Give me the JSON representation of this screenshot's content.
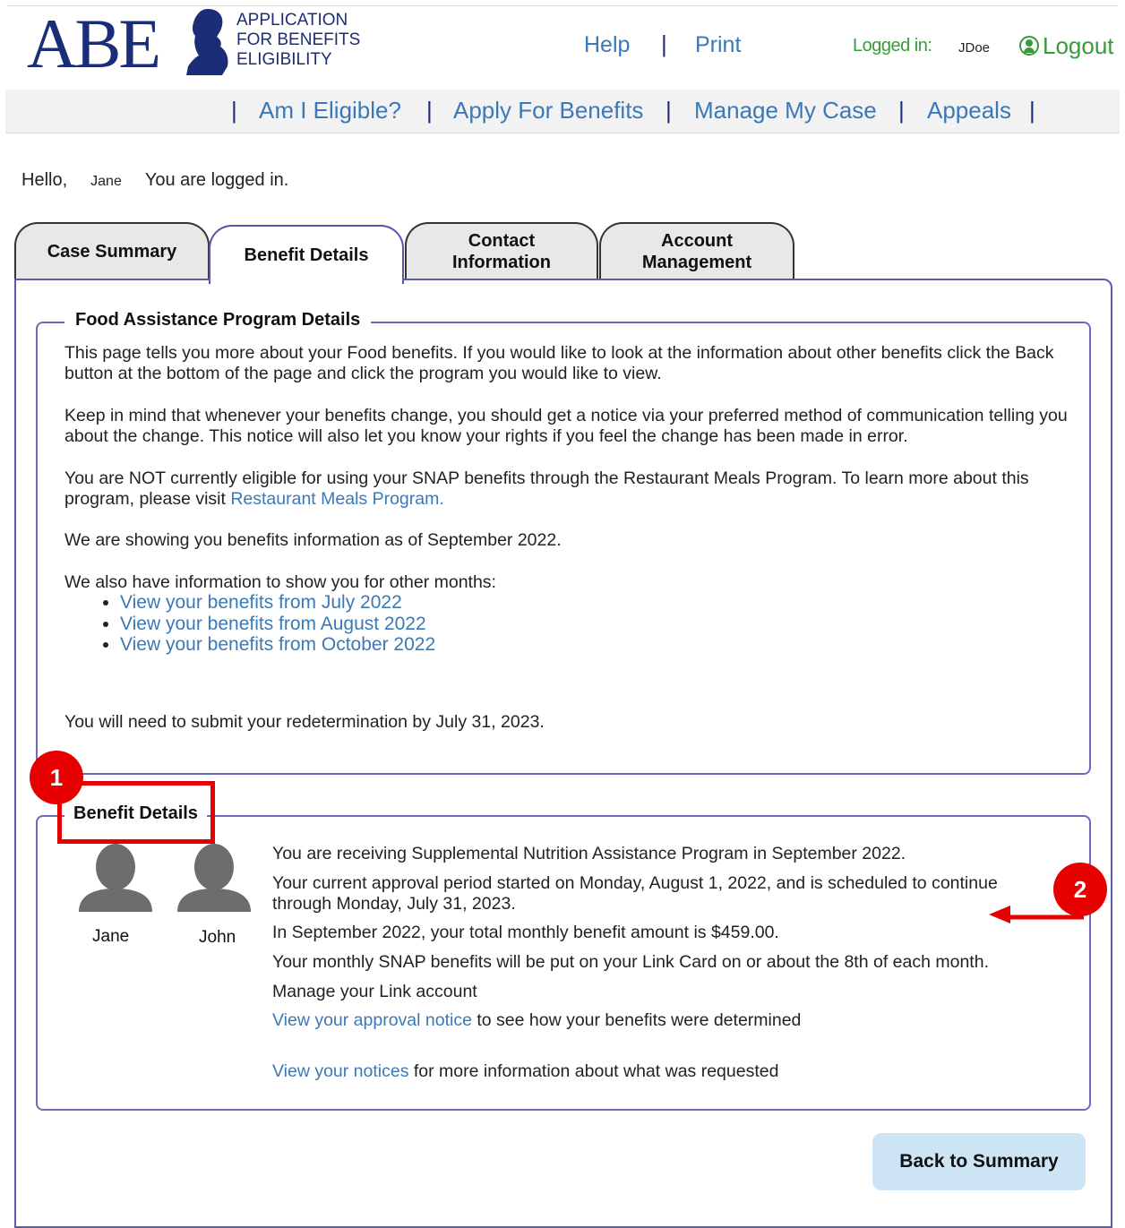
{
  "header": {
    "logo": "ABE",
    "logo_sub": [
      "APPLICATION",
      "FOR BENEFITS",
      "ELIGIBILITY"
    ],
    "help": "Help",
    "print": "Print",
    "sep": "|",
    "logged_in_label": "Logged in:",
    "username": "JDoe",
    "logout": "Logout"
  },
  "nav": {
    "sep": "|",
    "items": [
      "Am I Eligible?",
      "Apply For Benefits",
      "Manage My Case",
      "Appeals"
    ]
  },
  "greeting": {
    "hello": "Hello,",
    "name": "Jane",
    "status": "You are logged in."
  },
  "tabs": [
    {
      "label_1": "Case Summary",
      "label_2": ""
    },
    {
      "label_1": "Benefit Details",
      "label_2": ""
    },
    {
      "label_1": "Contact",
      "label_2": "Information"
    },
    {
      "label_1": "Account",
      "label_2": "Management"
    }
  ],
  "food": {
    "legend": "Food Assistance Program Details",
    "p1": "This page tells you more about your Food benefits. If you would like to look at the information about other benefits click the Back button at the bottom of the page and click the program you would like to view.",
    "p2": "Keep in mind that whenever your benefits change, you should get a notice via your preferred method of communication telling you about the change. This notice will also let you know your rights if you feel the change has been made in error.",
    "p3": "You are NOT currently eligible for using your SNAP benefits through the Restaurant Meals Program. To learn more about this program, please visit ",
    "p3_link": "Restaurant Meals Program.",
    "p4": "We are showing you benefits information as of September 2022.",
    "p5": "We also have information to show you for other months:",
    "months": [
      "View your benefits from July 2022",
      "View your benefits from August 2022",
      "View your benefits from October 2022"
    ],
    "p6": "You will need to submit your redetermination by July 31, 2023."
  },
  "benefit": {
    "legend": "Benefit Details",
    "people": [
      "Jane",
      "John"
    ],
    "l1": "You are receiving Supplemental Nutrition Assistance Program in September 2022.",
    "l2a": "Your current approval period started on Monday, August 1, 2022, and is scheduled to continue",
    "l2b": "through Monday, July 31, 2023.",
    "l3": "In September 2022, your total monthly benefit amount is $459.00.",
    "l4": "Your monthly SNAP benefits will be put on your Link Card on or about the 8th of each month.",
    "manage_link": "Manage your Link account",
    "approval_link": "View your approval notice",
    "approval_rest": " to see how your benefits were determined",
    "notices_link": "View your notices",
    "notices_rest": " for more information about what was requested"
  },
  "annotations": {
    "badge1": "1",
    "badge2": "2",
    "color": "#e60000"
  },
  "back_button": "Back to Summary"
}
